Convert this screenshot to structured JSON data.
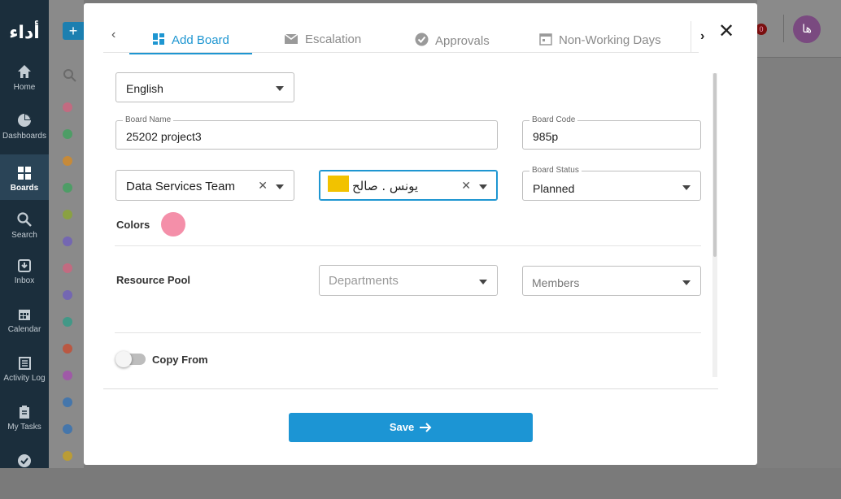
{
  "app": {
    "logo_text": "أداء",
    "avatar_initials": "ها",
    "notification_count": "0"
  },
  "sidebar": {
    "items": [
      {
        "label": "Home",
        "icon": "home-icon"
      },
      {
        "label": "Dashboards",
        "icon": "pie-chart-icon"
      },
      {
        "label": "Boards",
        "icon": "boards-icon",
        "active": true
      },
      {
        "label": "Search",
        "icon": "search-icon"
      },
      {
        "label": "Inbox",
        "icon": "inbox-icon"
      },
      {
        "label": "Calendar",
        "icon": "calendar-icon"
      },
      {
        "label": "Activity Log",
        "icon": "activity-log-icon"
      },
      {
        "label": "My Tasks",
        "icon": "tasks-icon"
      }
    ]
  },
  "background": {
    "add_button": "+",
    "dot_colors": [
      "#d4607d",
      "#3aa35a",
      "#d98a1e",
      "#3aa35a",
      "#8aa82a",
      "#6c5bbf",
      "#d4607d",
      "#6c5bbf",
      "#2a9c86",
      "#c9472a",
      "#a64ab0",
      "#2e6fb5",
      "#2e6fb5",
      "#caa21a"
    ]
  },
  "modal": {
    "tabs": [
      {
        "label": "Add Board",
        "icon": "grid-icon",
        "active": true
      },
      {
        "label": "Escalation",
        "icon": "envelope-icon"
      },
      {
        "label": "Approvals",
        "icon": "check-circle-icon"
      },
      {
        "label": "Non-Working Days",
        "icon": "calendar-icon"
      }
    ],
    "language": "English",
    "board_name": {
      "label": "Board Name",
      "value": "25202 project3"
    },
    "board_code": {
      "label": "Board Code",
      "value": "985p"
    },
    "team": {
      "value": "Data Services Team"
    },
    "owner": {
      "value": "يونس . صالح"
    },
    "board_status": {
      "label": "Board Status",
      "value": "Planned"
    },
    "colors_label": "Colors",
    "selected_color": "#f48fa9",
    "resource_pool_label": "Resource Pool",
    "departments_placeholder": "Departments",
    "members_placeholder": "Members",
    "copy_from_label": "Copy From",
    "save_label": "Save",
    "accent_color": "#1e96d1"
  }
}
